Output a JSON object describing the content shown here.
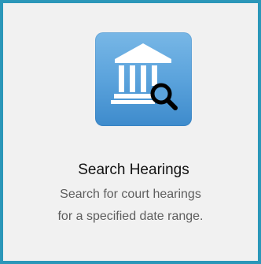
{
  "tile": {
    "title": "Search Hearings",
    "description_line1": "Search for court hearings",
    "description_line2": "for a specified date range.",
    "icon": "courthouse-search-icon",
    "colors": {
      "border": "#2b97b9",
      "background": "#f1f1f1",
      "icon_bg": "#5ba3dc",
      "title": "#111111",
      "description": "#5e5e5e"
    }
  }
}
